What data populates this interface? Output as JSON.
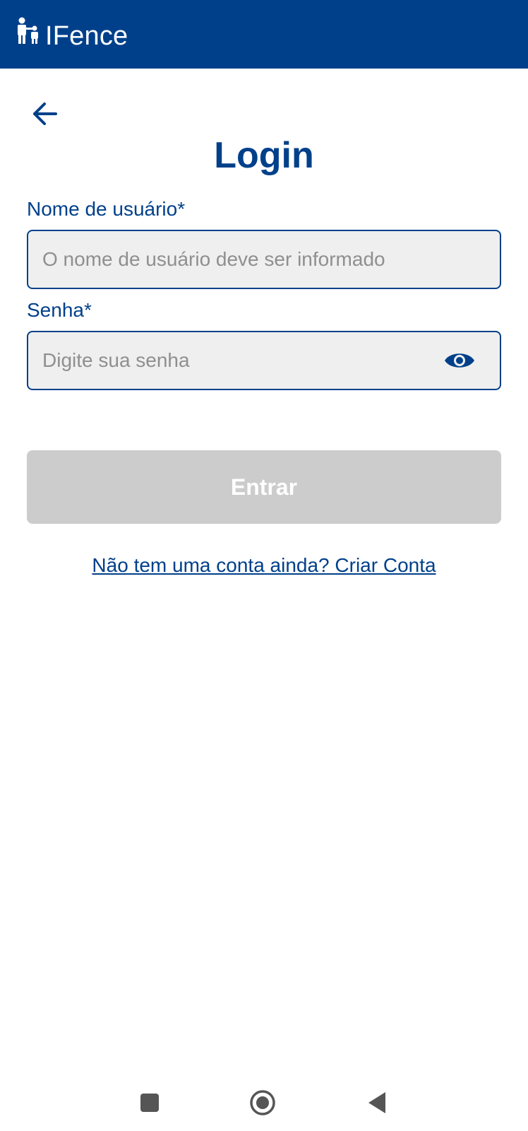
{
  "app_bar": {
    "title": "IFence",
    "logo_icon": "parent-child-icon",
    "background": "#00408A"
  },
  "back_button": {
    "icon": "arrow-left-icon"
  },
  "page": {
    "title": "Login"
  },
  "form": {
    "username": {
      "label": "Nome de usuário*",
      "placeholder": "O nome de usuário deve ser informado",
      "value": ""
    },
    "password": {
      "label": "Senha*",
      "placeholder": "Digite sua senha",
      "value": "",
      "toggle_icon": "eye-icon"
    },
    "submit_label": "Entrar"
  },
  "create_account_link": "Não tem uma conta ainda? Criar Conta",
  "system_nav": {
    "recents_icon": "square-icon",
    "home_icon": "circle-home-icon",
    "back_icon": "triangle-back-icon"
  },
  "colors": {
    "primary": "#00408A",
    "input_bg": "#EFEFEF",
    "button_disabled": "#CCCCCC",
    "system_nav": "#555555"
  }
}
